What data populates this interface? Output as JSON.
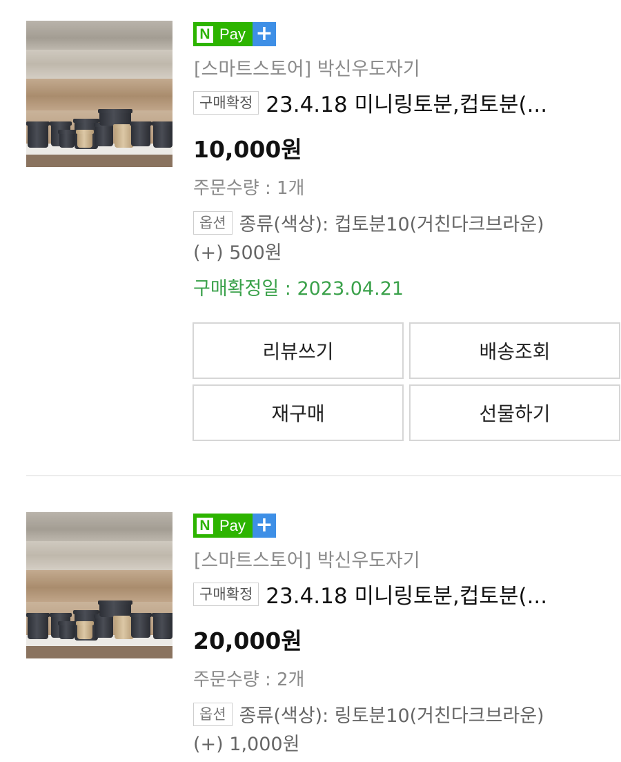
{
  "orders": [
    {
      "npay_n": "N",
      "npay_pay": "Pay",
      "npay_plus": "+",
      "store": "[스마트스토어] 박신우도자기",
      "status_badge": "구매확정",
      "title": "23.4.18 미니링토분,컵토분(...",
      "price": "10,000원",
      "quantity": "주문수량 : 1개",
      "option_badge": "옵션",
      "option": "종류(색상): 컵토분10(거친다크브라운)",
      "option_extra": "(+) 500원",
      "confirm_date": "구매확정일 : 2023.04.21",
      "buttons": {
        "review": "리뷰쓰기",
        "tracking": "배송조회",
        "rebuy": "재구매",
        "gift": "선물하기"
      }
    },
    {
      "npay_n": "N",
      "npay_pay": "Pay",
      "npay_plus": "+",
      "store": "[스마트스토어] 박신우도자기",
      "status_badge": "구매확정",
      "title": "23.4.18 미니링토분,컵토분(...",
      "price": "20,000원",
      "quantity": "주문수량 : 2개",
      "option_badge": "옵션",
      "option": "종류(색상): 링토분10(거친다크브라운)",
      "option_extra": "(+) 1,000원"
    }
  ],
  "colors": {
    "npay_green": "#2db400",
    "npay_blue": "#3e8fe6",
    "confirm_green": "#3aa14a",
    "muted_text": "#8a8a8a"
  }
}
